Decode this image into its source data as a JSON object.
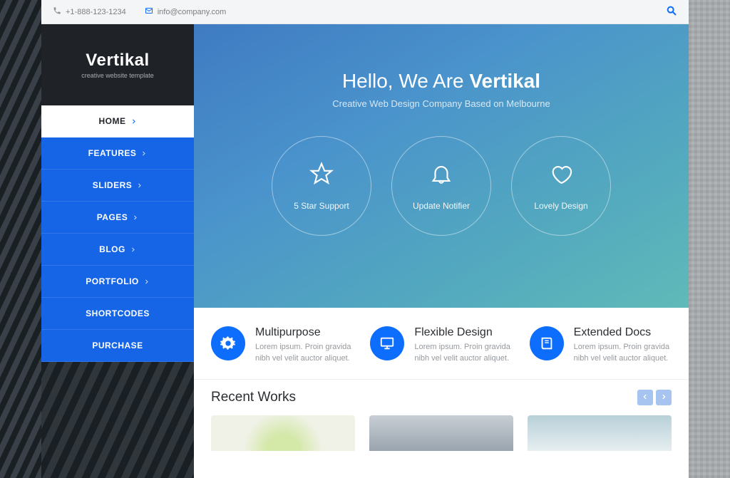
{
  "topbar": {
    "phone": "+1-888-123-1234",
    "email": "info@company.com"
  },
  "brand": {
    "name": "Vertikal",
    "tagline": "creative website template"
  },
  "nav": [
    {
      "label": "HOME",
      "chevron": true,
      "active": true
    },
    {
      "label": "FEATURES",
      "chevron": true,
      "active": false
    },
    {
      "label": "SLIDERS",
      "chevron": true,
      "active": false
    },
    {
      "label": "PAGES",
      "chevron": true,
      "active": false
    },
    {
      "label": "BLOG",
      "chevron": true,
      "active": false
    },
    {
      "label": "PORTFOLIO",
      "chevron": true,
      "active": false
    },
    {
      "label": "SHORTCODES",
      "chevron": false,
      "active": false
    },
    {
      "label": "PURCHASE",
      "chevron": false,
      "active": false
    }
  ],
  "hero": {
    "title_prefix": "Hello, We Are ",
    "title_bold": "Vertikal",
    "subtitle": "Creative Web Design Company Based on Melbourne",
    "circles": [
      {
        "icon": "star-icon",
        "label": "5 Star Support"
      },
      {
        "icon": "bell-icon",
        "label": "Update Notifier"
      },
      {
        "icon": "heart-icon",
        "label": "Lovely Design"
      }
    ]
  },
  "features": [
    {
      "icon": "gears-icon",
      "title": "Multipurpose",
      "desc": "Lorem ipsum. Proin gravida nibh vel velit auctor aliquet."
    },
    {
      "icon": "monitor-icon",
      "title": "Flexible Design",
      "desc": "Lorem ipsum. Proin gravida nibh vel velit auctor aliquet."
    },
    {
      "icon": "book-icon",
      "title": "Extended Docs",
      "desc": "Lorem ipsum. Proin gravida nibh vel velit auctor aliquet."
    }
  ],
  "recent": {
    "title": "Recent Works"
  },
  "colors": {
    "primary": "#0d6efd",
    "nav_blue": "#1565e6",
    "dark": "#1f2328"
  }
}
